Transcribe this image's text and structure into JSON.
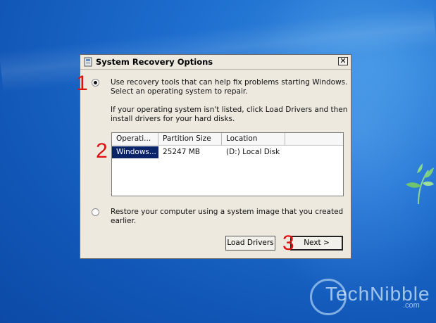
{
  "dialog": {
    "title": "System Recovery Options",
    "close_glyph": "✕",
    "option1_line1": "Use recovery tools that can help fix problems starting Windows.",
    "option1_line2": "Select an operating system to repair.",
    "info_line1": "If your operating system isn't listed, click Load Drivers and then",
    "info_line2": "install drivers for your hard disks.",
    "option2_line1": "Restore your computer using a system image that you created",
    "option2_line2": "earlier.",
    "load_drivers_label": "Load Drivers",
    "next_label": "Next >",
    "selected_option": 1
  },
  "os_table": {
    "columns": [
      "Operati...",
      "Partition Size",
      "Location"
    ],
    "rows": [
      {
        "os": "Windows...",
        "size": "25247 MB",
        "location": "(D:) Local Disk",
        "selected": true
      }
    ]
  },
  "annotations": [
    "1",
    "2",
    "3"
  ],
  "watermark": {
    "brand": "TechNibble",
    "suffix": ".com"
  },
  "colors": {
    "desktop": "#1e6fd0",
    "dialog_bg": "#ede9df",
    "selection": "#0a246a",
    "annotation": "#e01010"
  },
  "icons": [
    "window-icon",
    "close-icon",
    "windows-leaf-icon"
  ]
}
